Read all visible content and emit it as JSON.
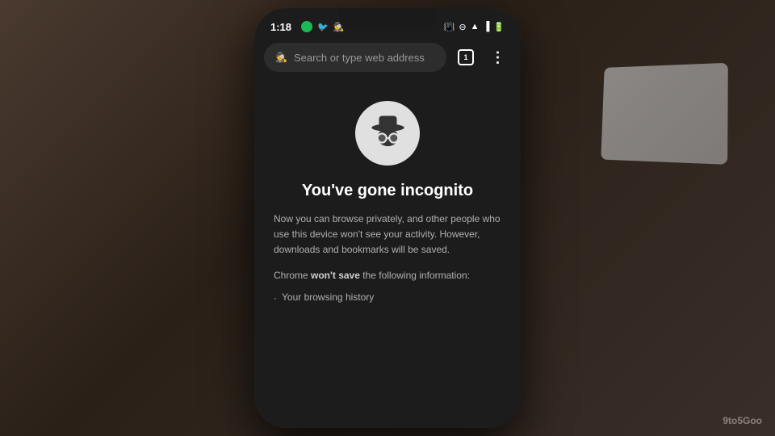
{
  "scene": {
    "background_color": "#3a2e28"
  },
  "status_bar": {
    "time": "1:18",
    "app_icons": [
      "spotify",
      "twitter",
      "spy"
    ],
    "system_icons": [
      "vibrate",
      "minus-circle",
      "wifi",
      "signal",
      "battery"
    ]
  },
  "browser_toolbar": {
    "search_placeholder": "Search or type web address",
    "tab_count": "1",
    "incognito_icon": "🕵",
    "menu_icon": "⋮"
  },
  "incognito_page": {
    "title": "You've gone incognito",
    "body_text": "Now you can browse privately, and other people who use this device won't see your activity. However, downloads and bookmarks will be saved.",
    "chrome_note_prefix": "Chrome ",
    "chrome_note_bold": "won't save",
    "chrome_note_suffix": " the following information:",
    "bullet_items": [
      "Your browsing history"
    ]
  },
  "watermark": {
    "text": "9to5Goo"
  }
}
